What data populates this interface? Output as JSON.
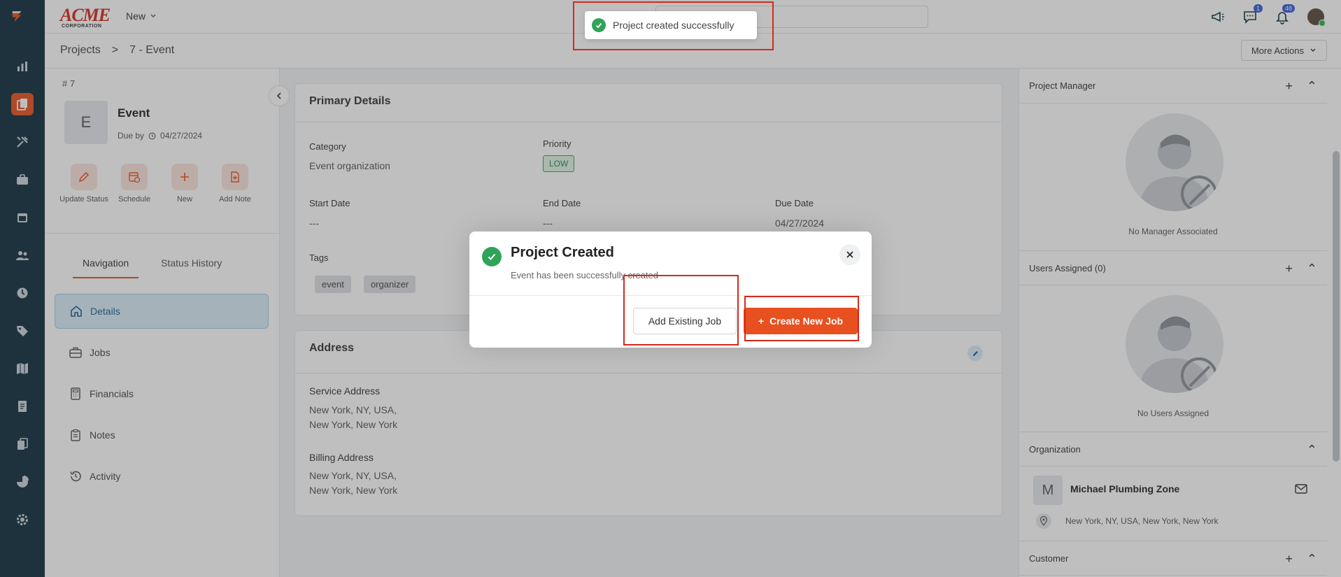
{
  "app": {
    "brand_word": "ACME",
    "brand_sub": "CORPORATION",
    "new_menu_label": "New",
    "badges": {
      "messages": "1",
      "notifications": "48"
    },
    "accent_color": "#e8501f",
    "rail_color": "#0e2d3d"
  },
  "rail": {
    "items": [
      "dashboard-icon",
      "projects-icon",
      "tools-icon",
      "briefcase-icon",
      "calendar-icon",
      "users-icon",
      "clock-icon",
      "tag-icon",
      "map-icon",
      "invoice-icon",
      "documents-icon",
      "reports-icon",
      "settings-icon"
    ],
    "active": "projects-icon"
  },
  "breadcrumb": {
    "root": "Projects",
    "separator": ">",
    "current": "7 - Event"
  },
  "more_actions_label": "More Actions",
  "project": {
    "number": "# 7",
    "avatar_letter": "E",
    "name": "Event",
    "due_prefix": "Due by",
    "due_date": "04/27/2024"
  },
  "quick_actions": [
    {
      "label": "Update Status",
      "icon": "pencil-icon"
    },
    {
      "label": "Schedule",
      "icon": "calendar-clock-icon"
    },
    {
      "label": "New",
      "icon": "plus-icon"
    },
    {
      "label": "Add Note",
      "icon": "note-add-icon"
    }
  ],
  "tabs": {
    "navigation": "Navigation",
    "status_history": "Status History"
  },
  "nav": [
    {
      "label": "Details",
      "icon": "home-icon",
      "active": true
    },
    {
      "label": "Jobs",
      "icon": "briefcase-icon",
      "active": false
    },
    {
      "label": "Financials",
      "icon": "calculator-icon",
      "active": false
    },
    {
      "label": "Notes",
      "icon": "clipboard-icon",
      "active": false
    },
    {
      "label": "Activity",
      "icon": "history-icon",
      "active": false
    }
  ],
  "primary_details": {
    "title": "Primary Details",
    "category_label": "Category",
    "category_value": "Event organization",
    "priority_label": "Priority",
    "priority_value": "LOW",
    "start_label": "Start Date",
    "start_value": "---",
    "end_label": "End Date",
    "end_value": "---",
    "due_label": "Due Date",
    "due_value": "04/27/2024",
    "tags_label": "Tags",
    "tags": [
      "event",
      "organizer"
    ]
  },
  "address": {
    "title": "Address",
    "service_label": "Service Address",
    "service_line1": "New York, NY, USA,",
    "service_line2": "New York, New York",
    "billing_label": "Billing Address",
    "billing_line1": "New York, NY, USA,",
    "billing_line2": "New York, New York"
  },
  "right": {
    "manager_title": "Project Manager",
    "manager_empty": "No Manager Associated",
    "users_title": "Users Assigned (0)",
    "users_empty": "No Users Assigned",
    "org_title": "Organization",
    "org_letter": "M",
    "org_name": "Michael Plumbing Zone",
    "org_address": "New York, NY, USA, New York, New York",
    "customer_title": "Customer"
  },
  "modal": {
    "title": "Project Created",
    "subtitle": "Event has been successfully created",
    "add_existing_label": "Add Existing Job",
    "create_new_label": "Create New Job",
    "create_prefix": "+"
  },
  "toast": {
    "message": "Project created successfully"
  }
}
